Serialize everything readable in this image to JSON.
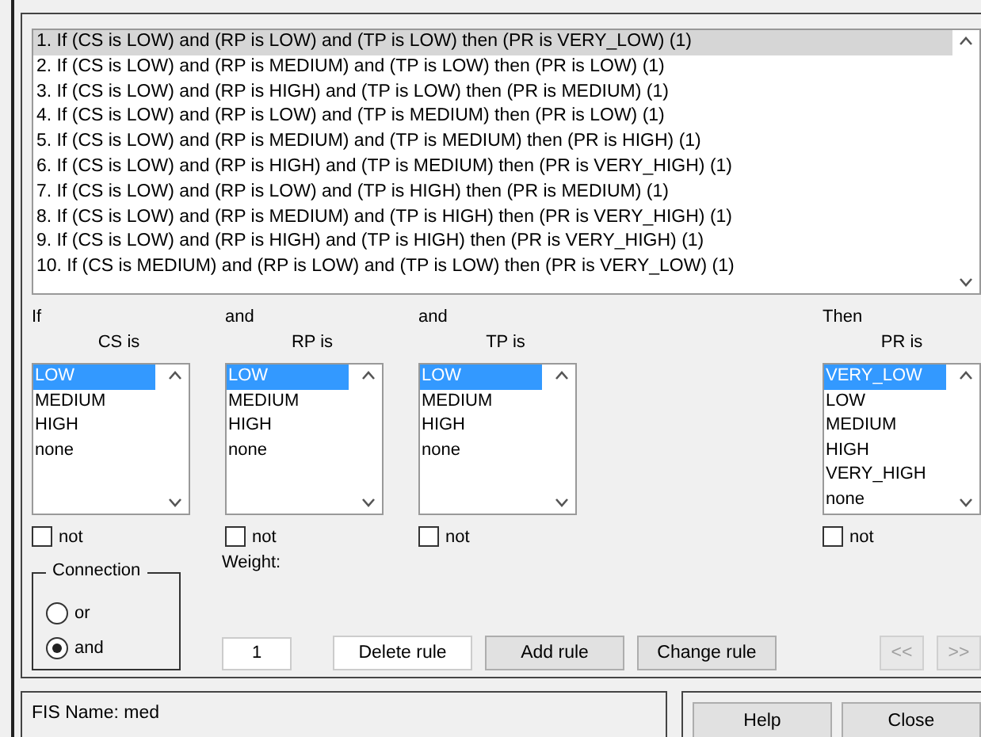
{
  "rules": [
    {
      "text": "1. If (CS is LOW) and (RP is LOW) and (TP is LOW) then (PR is VERY_LOW) (1)",
      "selected": true
    },
    {
      "text": "2. If (CS is LOW) and (RP is MEDIUM) and (TP is LOW) then (PR is LOW) (1)",
      "selected": false
    },
    {
      "text": "3. If (CS is LOW) and (RP is HIGH) and (TP is LOW) then (PR is MEDIUM) (1)",
      "selected": false
    },
    {
      "text": "4. If (CS is LOW) and (RP is LOW) and (TP is MEDIUM) then (PR is LOW) (1)",
      "selected": false
    },
    {
      "text": "5. If (CS is LOW) and (RP is MEDIUM) and (TP is MEDIUM) then (PR is HIGH) (1)",
      "selected": false
    },
    {
      "text": "6. If (CS is LOW) and (RP is HIGH) and (TP is MEDIUM) then (PR is VERY_HIGH) (1)",
      "selected": false
    },
    {
      "text": "7. If (CS is LOW) and (RP is LOW) and (TP is HIGH) then (PR is MEDIUM) (1)",
      "selected": false
    },
    {
      "text": "8. If (CS is LOW) and (RP is MEDIUM) and (TP is HIGH) then (PR is VERY_HIGH) (1)",
      "selected": false
    },
    {
      "text": "9. If (CS is LOW) and (RP is HIGH) and (TP is HIGH) then (PR is VERY_HIGH) (1)",
      "selected": false
    },
    {
      "text": "10. If (CS is MEDIUM) and (RP is LOW) and (TP is LOW) then (PR is VERY_LOW) (1)",
      "selected": false
    }
  ],
  "variables": [
    {
      "kind": "input",
      "keyword": "If",
      "label": "CS is",
      "options": [
        {
          "text": "LOW",
          "selected": true
        },
        {
          "text": "MEDIUM",
          "selected": false
        },
        {
          "text": "HIGH",
          "selected": false
        },
        {
          "text": "none",
          "selected": false
        }
      ],
      "not_label": "not",
      "not_checked": false
    },
    {
      "kind": "input",
      "keyword": "and",
      "label": "RP is",
      "options": [
        {
          "text": "LOW",
          "selected": true
        },
        {
          "text": "MEDIUM",
          "selected": false
        },
        {
          "text": "HIGH",
          "selected": false
        },
        {
          "text": "none",
          "selected": false
        }
      ],
      "not_label": "not",
      "not_checked": false
    },
    {
      "kind": "input",
      "keyword": "and",
      "label": "TP is",
      "options": [
        {
          "text": "LOW",
          "selected": true
        },
        {
          "text": "MEDIUM",
          "selected": false
        },
        {
          "text": "HIGH",
          "selected": false
        },
        {
          "text": "none",
          "selected": false
        }
      ],
      "not_label": "not",
      "not_checked": false
    },
    {
      "kind": "output",
      "keyword": "Then",
      "label": "PR is",
      "options": [
        {
          "text": "VERY_LOW",
          "selected": true
        },
        {
          "text": "LOW",
          "selected": false
        },
        {
          "text": "MEDIUM",
          "selected": false
        },
        {
          "text": "HIGH",
          "selected": false
        },
        {
          "text": "VERY_HIGH",
          "selected": false
        },
        {
          "text": "none",
          "selected": false
        }
      ],
      "not_label": "not",
      "not_checked": false
    }
  ],
  "connection": {
    "title": "Connection",
    "options": [
      {
        "label": "or",
        "selected": false
      },
      {
        "label": "and",
        "selected": true
      }
    ]
  },
  "weight": {
    "label": "Weight:",
    "value": "1"
  },
  "actions": [
    {
      "label": "Delete rule",
      "focused": true
    },
    {
      "label": "Add rule",
      "focused": false
    },
    {
      "label": "Change rule",
      "focused": false
    }
  ],
  "navigation": [
    {
      "label": "<<",
      "disabled": true
    },
    {
      "label": ">>",
      "disabled": true
    }
  ],
  "status": "FIS Name: med",
  "footer_buttons": [
    {
      "label": "Help"
    },
    {
      "label": "Close"
    }
  ]
}
